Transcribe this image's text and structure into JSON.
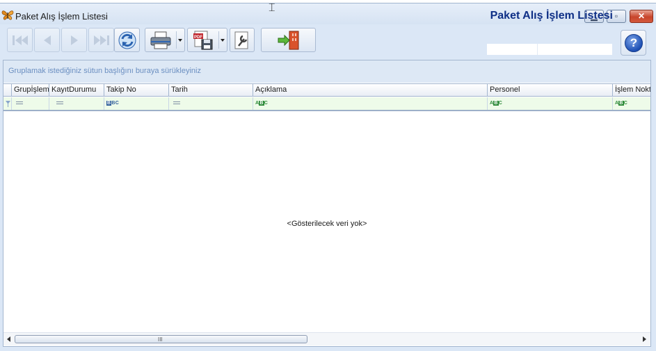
{
  "window": {
    "title": "Paket Alış İşlem Listesi",
    "minimize_label": "▁",
    "maximize_label": "▫",
    "close_label": "✕"
  },
  "toolbar": {
    "buttons": [
      {
        "name": "first-record",
        "enabled": false
      },
      {
        "name": "previous-record",
        "enabled": false
      },
      {
        "name": "next-record",
        "enabled": false
      },
      {
        "name": "last-record",
        "enabled": false
      },
      {
        "name": "refresh",
        "enabled": true
      },
      {
        "name": "print",
        "enabled": true
      },
      {
        "name": "export-pdf",
        "enabled": true
      },
      {
        "name": "settings",
        "enabled": true
      },
      {
        "name": "exit",
        "enabled": true
      }
    ]
  },
  "header": {
    "title": "Paket Alış İşlem Listesi",
    "help_label": "?"
  },
  "grid": {
    "group_panel_text": "Gruplamak istediğiniz sütun başlığını buraya sürükleyiniz",
    "columns": [
      {
        "label": "Grupİşlemi",
        "filter": "equals"
      },
      {
        "label": "KayıtDurumu",
        "filter": "equals"
      },
      {
        "label": "Takip No",
        "filter": "abc"
      },
      {
        "label": "Tarih",
        "filter": "equals"
      },
      {
        "label": "Açıklama",
        "filter": "abc"
      },
      {
        "label": "Personel",
        "filter": "abc"
      },
      {
        "label": "İşlem Noktası",
        "filter": "abc"
      }
    ],
    "empty_text": "<Gösterilecek veri yok>",
    "scroll_grip": "III"
  },
  "colors": {
    "accent": "#0e2f86",
    "window_bg": "#dbe7f6",
    "filter_row_bg": "#eefbe9",
    "group_text": "#6b8fc1"
  }
}
